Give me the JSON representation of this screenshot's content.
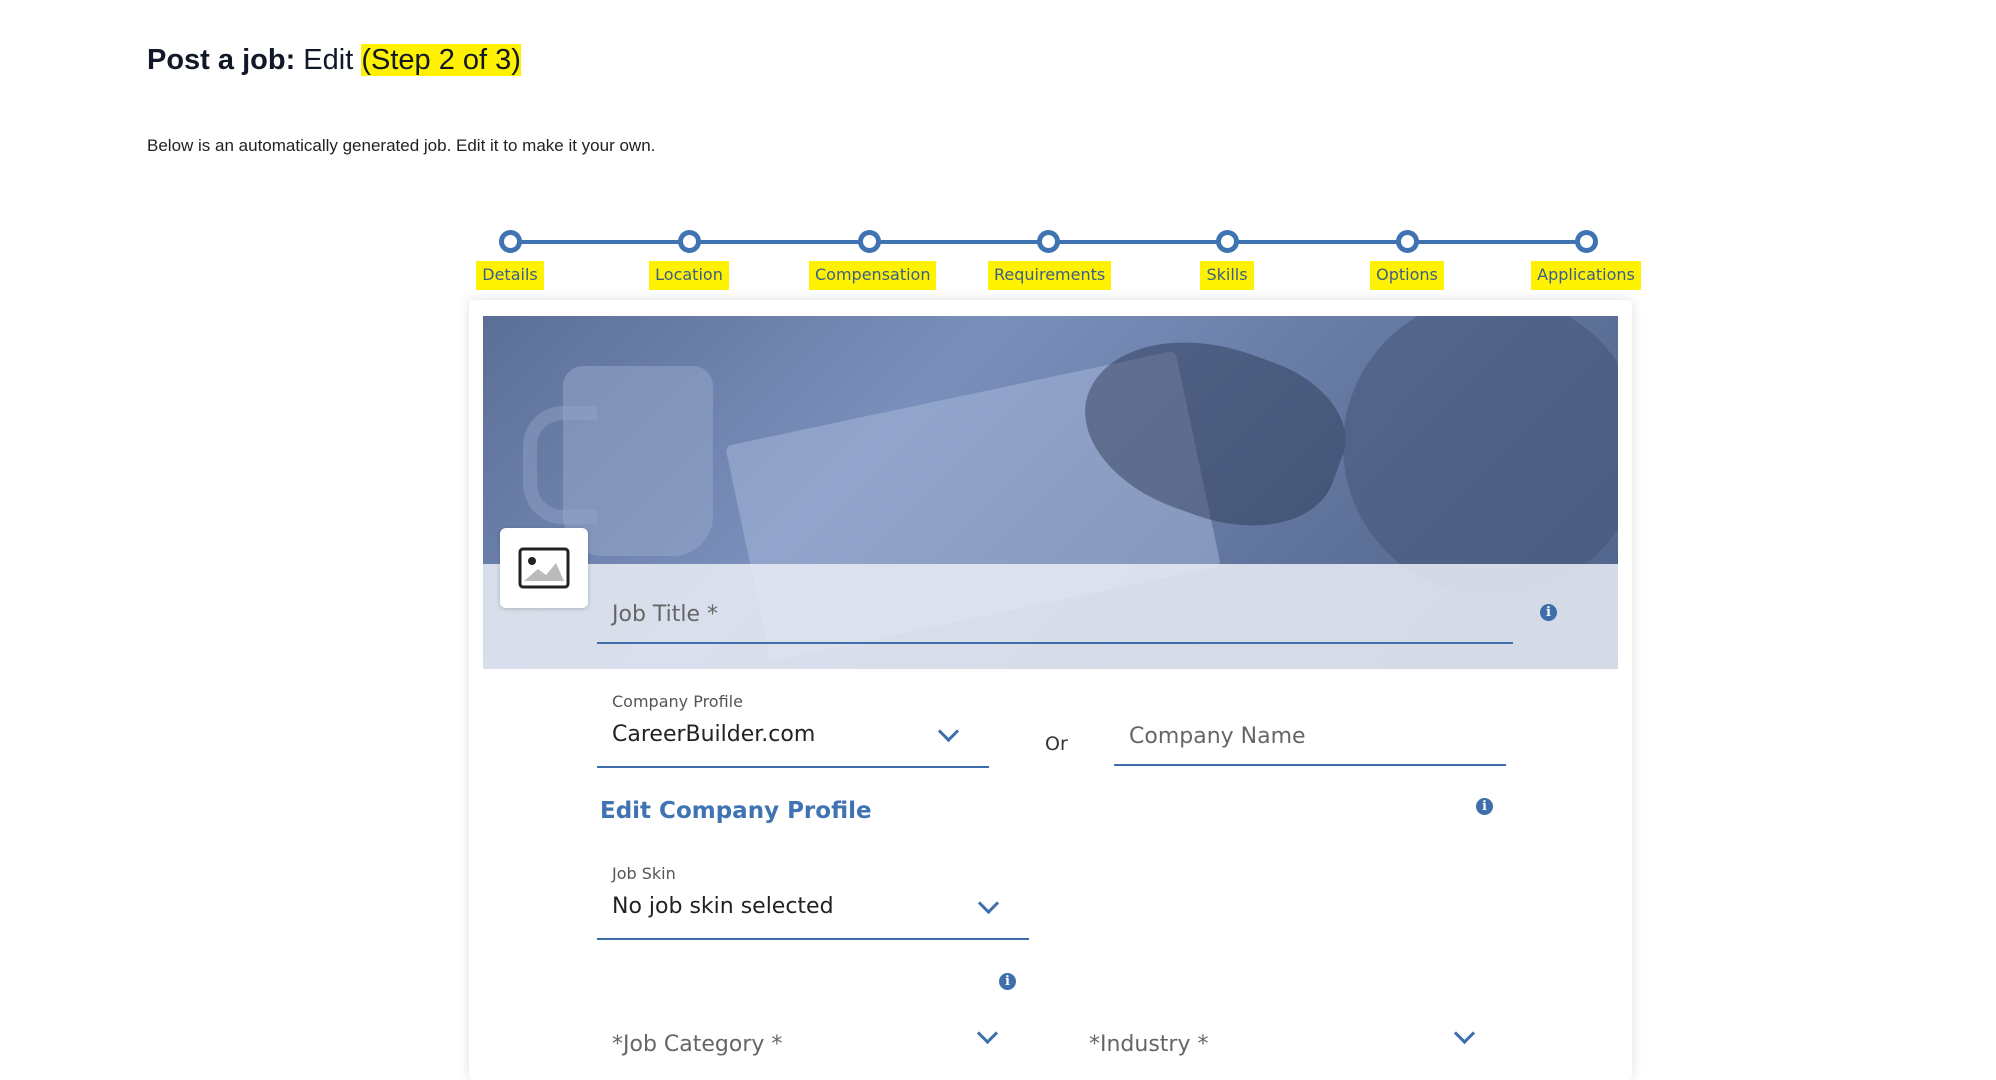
{
  "header": {
    "title_strong": "Post a job:",
    "title_mode": "Edit",
    "title_step": "(Step 2 of 3)",
    "intro": "Below is an automatically generated job. Edit it to make it your own."
  },
  "stepper": {
    "steps": [
      {
        "label": "Details"
      },
      {
        "label": "Location"
      },
      {
        "label": "Compensation"
      },
      {
        "label": "Requirements"
      },
      {
        "label": "Skills"
      },
      {
        "label": "Options"
      },
      {
        "label": "Applications"
      }
    ]
  },
  "form": {
    "job_title_placeholder": "Job Title *",
    "company_profile_label": "Company Profile",
    "company_profile_value": "CareerBuilder.com",
    "or_text": "Or",
    "company_name_placeholder": "Company Name",
    "edit_company_profile": "Edit Company Profile",
    "job_skin_label": "Job Skin",
    "job_skin_value": "No job skin selected",
    "job_category_placeholder": "*Job Category *",
    "industry_placeholder": "*Industry *"
  },
  "colors": {
    "accent": "#3f73b1",
    "highlight": "#fff200"
  },
  "icons": {
    "image_placeholder": "image-icon",
    "info": "info-icon",
    "dropdown": "chevron-down-icon"
  }
}
